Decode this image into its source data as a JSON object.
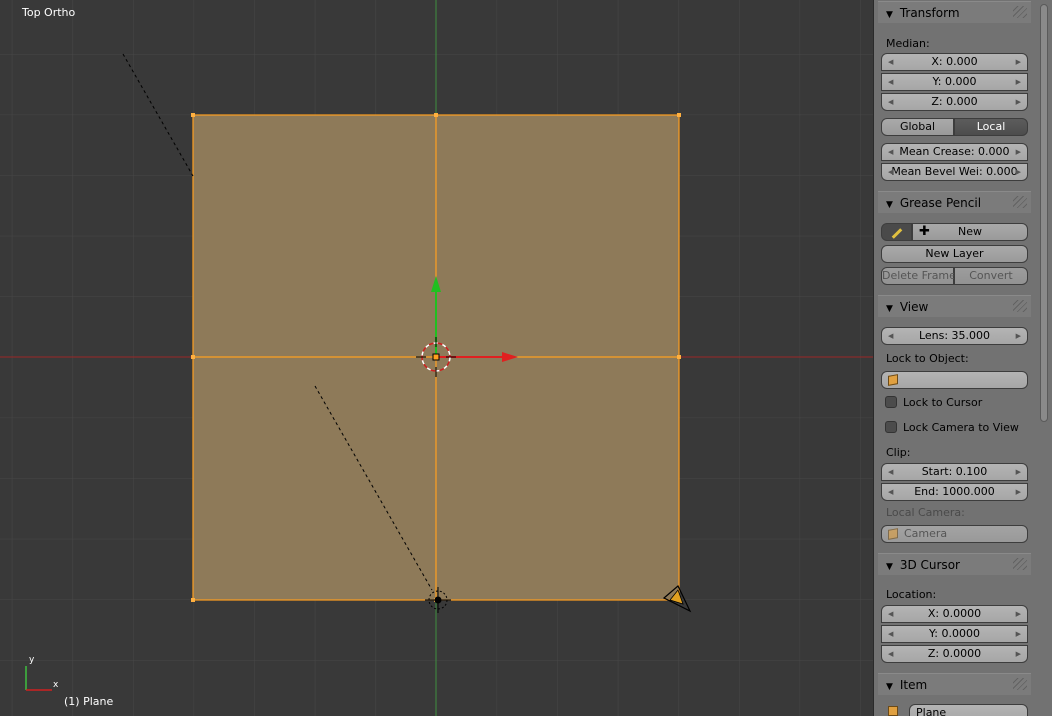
{
  "viewport": {
    "view_label": "Top Ortho",
    "object_label": "(1) Plane",
    "axis_y": "y",
    "axis_x": "x",
    "colors": {
      "background": "#393939",
      "grid": "#474747",
      "plane_fill": "#8e7a59",
      "plane_edge": "#ffa020",
      "axis_x": "#9c2626",
      "axis_y": "#3f8f3f"
    }
  },
  "sidebar": {
    "transform": {
      "title": "Transform",
      "median_label": "Median:",
      "x": "X: 0.000",
      "y": "Y: 0.000",
      "z": "Z: 0.000",
      "global_label": "Global",
      "local_label": "Local",
      "mean_crease": "Mean Crease: 0.000",
      "mean_bevel": "Mean Bevel Wei: 0.000"
    },
    "grease_pencil": {
      "title": "Grease Pencil",
      "new_label": "New",
      "new_layer_label": "New Layer",
      "delete_frame_label": "Delete Frame",
      "convert_label": "Convert"
    },
    "view": {
      "title": "View",
      "lens": "Lens: 35.000",
      "lock_to_object_label": "Lock to Object:",
      "lock_object_value": "",
      "lock_to_cursor_label": "Lock to Cursor",
      "lock_camera_label": "Lock Camera to View",
      "clip_label": "Clip:",
      "clip_start": "Start: 0.100",
      "clip_end": "End: 1000.000",
      "local_camera_label": "Local Camera:",
      "local_camera_value": "Camera"
    },
    "cursor": {
      "title": "3D Cursor",
      "location_label": "Location:",
      "x": "X: 0.0000",
      "y": "Y: 0.0000",
      "z": "Z: 0.0000"
    },
    "item": {
      "title": "Item",
      "name_value": "Plane"
    }
  }
}
